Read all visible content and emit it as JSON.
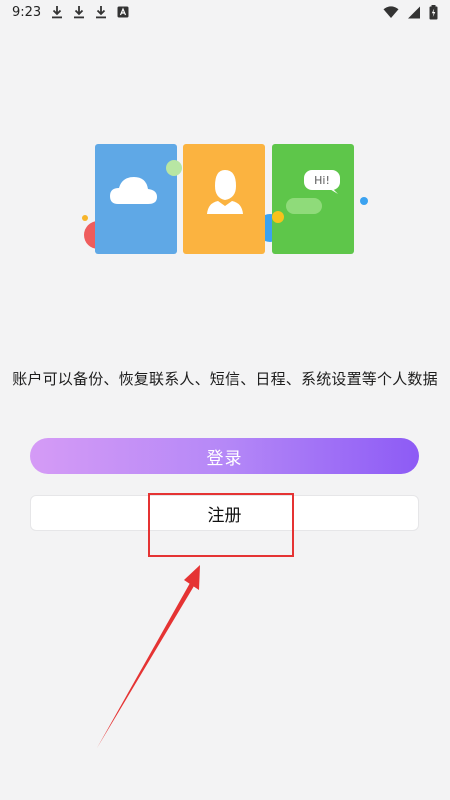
{
  "status_bar": {
    "time": "9:23",
    "notification_icons": [
      "download-icon",
      "download-icon",
      "download-icon",
      "text-icon"
    ],
    "right_icons": [
      "wifi-icon",
      "signal-icon",
      "battery-icon"
    ]
  },
  "illustration": {
    "chat_bubble_text": "Hi!",
    "colors": {
      "card_blue": "#5fa8e6",
      "card_orange": "#fbb340",
      "card_green": "#5ec64a"
    }
  },
  "info": {
    "text": "账户可以备份、恢复联系人、短信、日程、系统设置等个人数据"
  },
  "buttons": {
    "login_label": "登录",
    "register_label": "注册"
  },
  "colors": {
    "accent_start": "#d59bf6",
    "accent_end": "#8d5bf5",
    "annotation_red": "#e53333",
    "background": "#f3f3f4"
  }
}
